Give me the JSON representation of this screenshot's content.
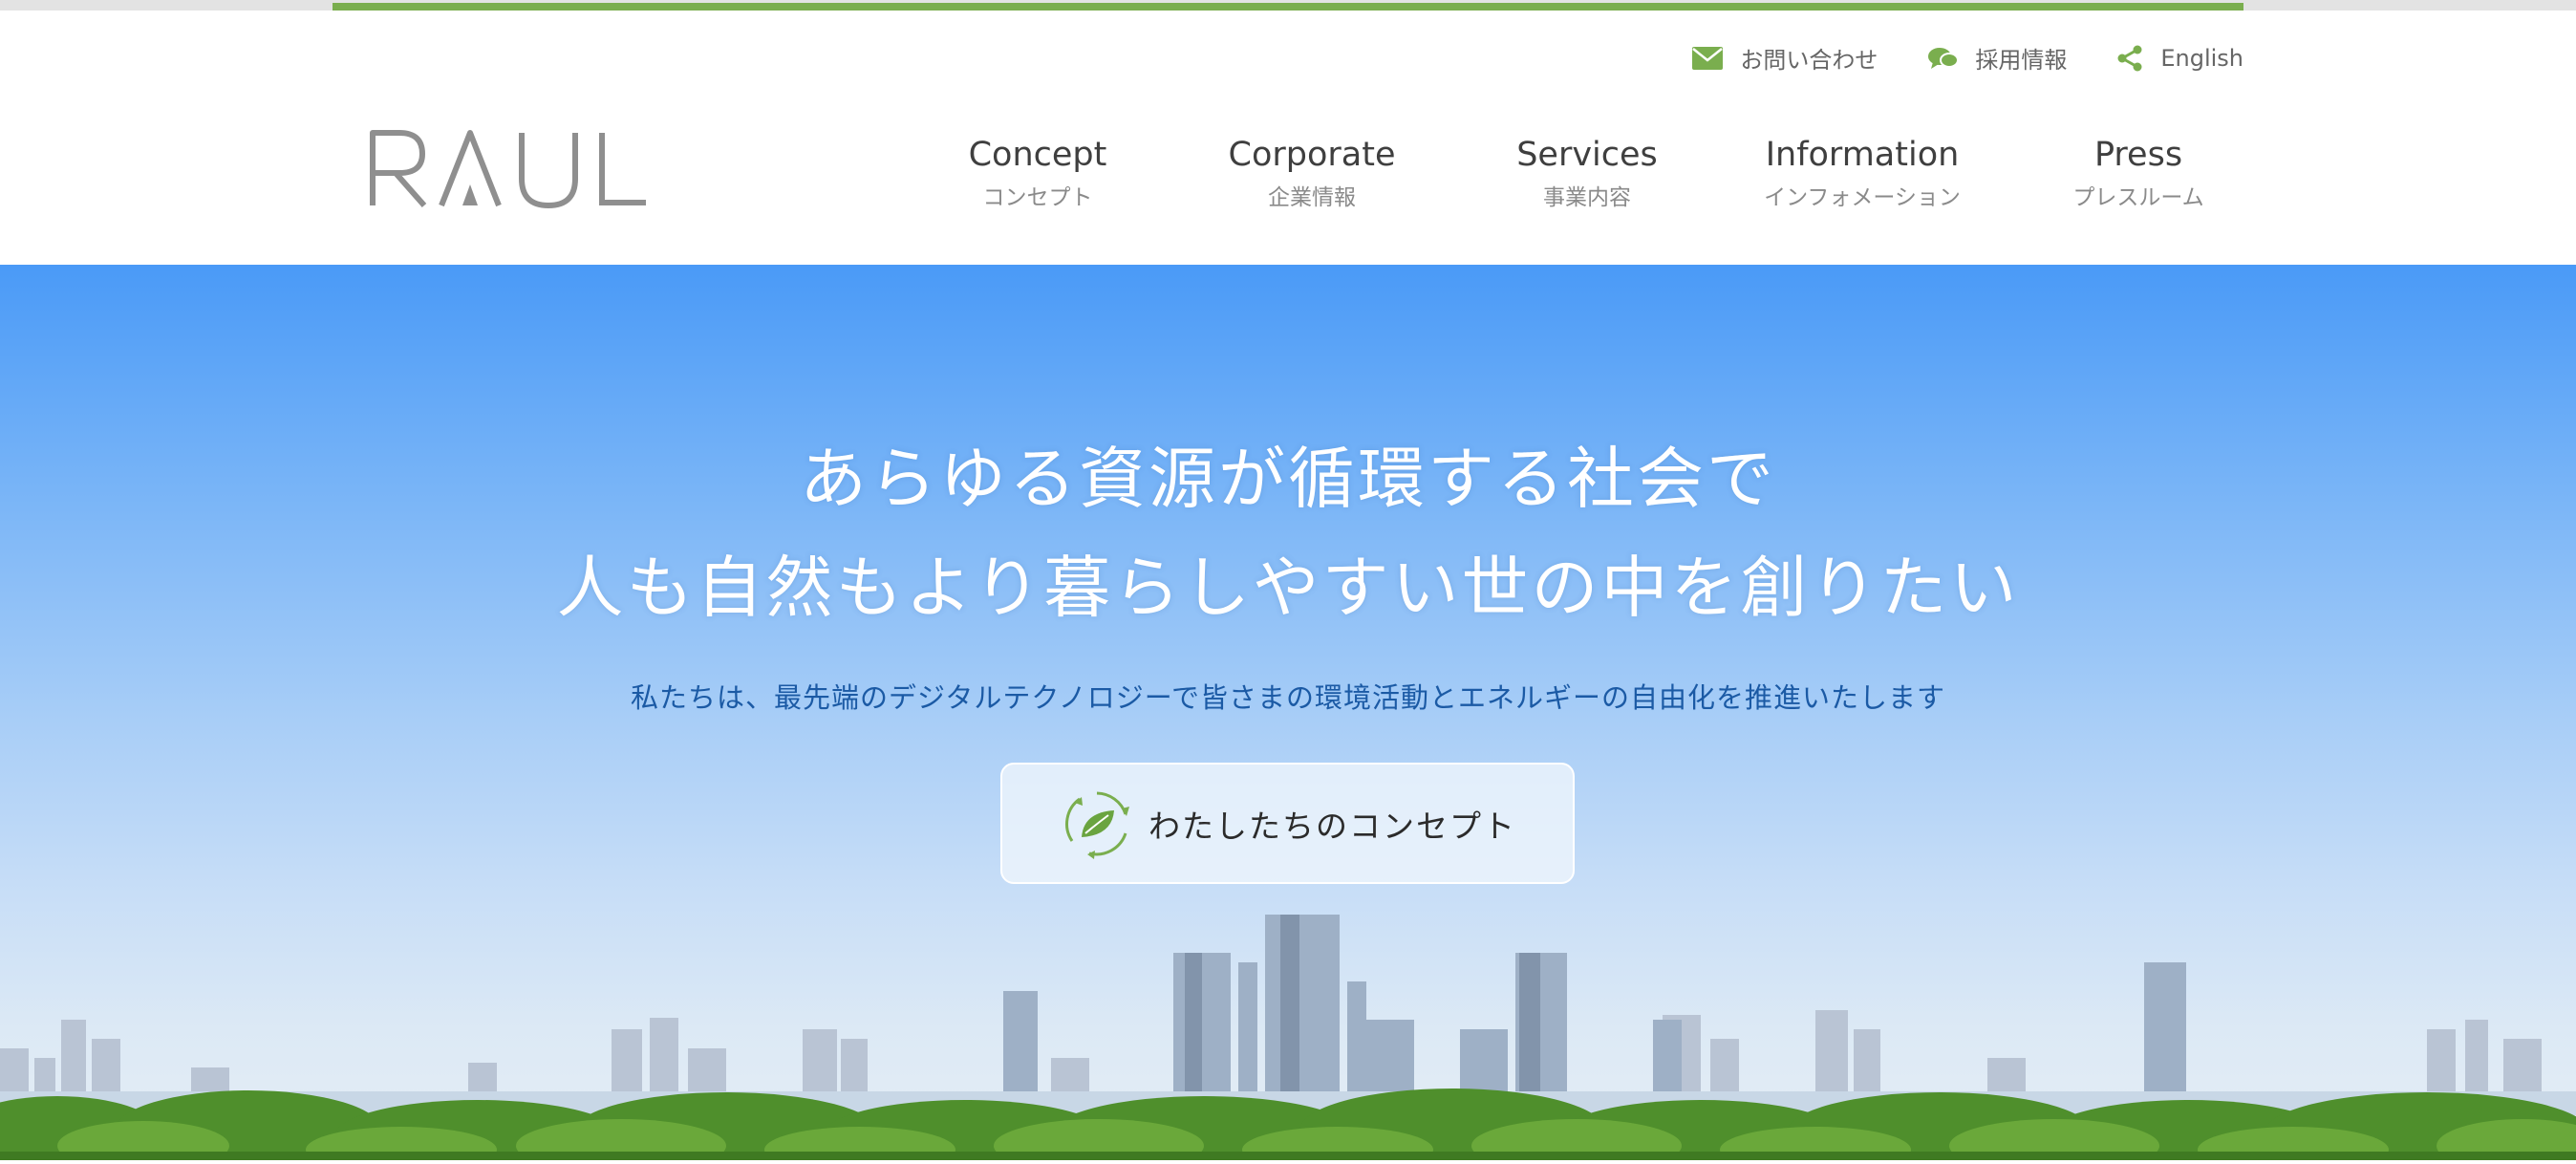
{
  "brand": {
    "logo_text": "RAUL",
    "accent_green": "#7aae4e",
    "logo_grey": "#8f8f8f"
  },
  "utility_links": [
    {
      "label": "お問い合わせ",
      "icon": "mail-icon"
    },
    {
      "label": "採用情報",
      "icon": "chat-bubbles-icon"
    },
    {
      "label": "English",
      "icon": "share-icon"
    }
  ],
  "nav": [
    {
      "en": "Concept",
      "jp": "コンセプト"
    },
    {
      "en": "Corporate",
      "jp": "企業情報"
    },
    {
      "en": "Services",
      "jp": "事業内容"
    },
    {
      "en": "Information",
      "jp": "インフォメーション"
    },
    {
      "en": "Press",
      "jp": "プレスルーム"
    }
  ],
  "hero": {
    "title_line1": "あらゆる資源が循環する社会で",
    "title_line2": "人も自然もより暮らしやすい世の中を創りたい",
    "subtitle": "私たちは、最先端のデジタルテクノロジーで皆さまの環境活動とエネルギーの自由化を推進いたします",
    "cta_label": "わたしたちのコンセプト",
    "cta_icon": "recycle-leaf-icon"
  }
}
